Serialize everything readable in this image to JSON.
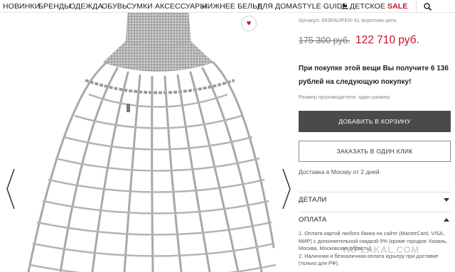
{
  "nav": {
    "items": [
      "НОВИНКИ",
      "БРЕНДЫ",
      "ОДЕЖДА",
      "ОБУВЬ",
      "СУМКИ",
      "АКСЕССУАРЫ",
      "НИЖНЕЕ БЕЛЬЕ",
      "ДЛЯ ДОМА",
      "STYLE GUIDE",
      "ДЕТСКОЕ",
      "SALE"
    ],
    "sale_color": "#c8102e",
    "search_icon": "search-icon"
  },
  "product": {
    "sku": "Артикул: 693PAUPER-XL воротник цепь",
    "old_price": "175 300 руб.",
    "new_price": "122 710 руб.",
    "bonus": "При покупке этой вещи Вы получите 6 136 рублей на следующую покупку!",
    "size_note": "Размер производителя: один размер",
    "add_to_cart": "ДОБАВИТЬ В КОРЗИНУ",
    "one_click": "ЗАКАЗАТЬ В ОДИН КЛИК",
    "delivery": "Доставка в Москву от 2 дней."
  },
  "accordion": {
    "details_label": "ДЕТАЛИ",
    "payment_label": "ОПЛАТА",
    "payment_line1": "1. Оплата картой любого банка на сайте (MasterCard, VISA, МИР) с дополнительной скидкой 5% (кроме городов: Казань, Москва, Московская область).",
    "payment_line2": "2. Наличная и безналичная оплата курьеру при доставке (только для РФ)."
  },
  "gallery": {
    "prev_icon": "chevron-left-icon",
    "next_icon": "chevron-right-icon"
  },
  "watermark": "YAPLAKAL.COM",
  "colors": {
    "accent": "#c8102e",
    "button_dark": "#4a4a4a"
  }
}
